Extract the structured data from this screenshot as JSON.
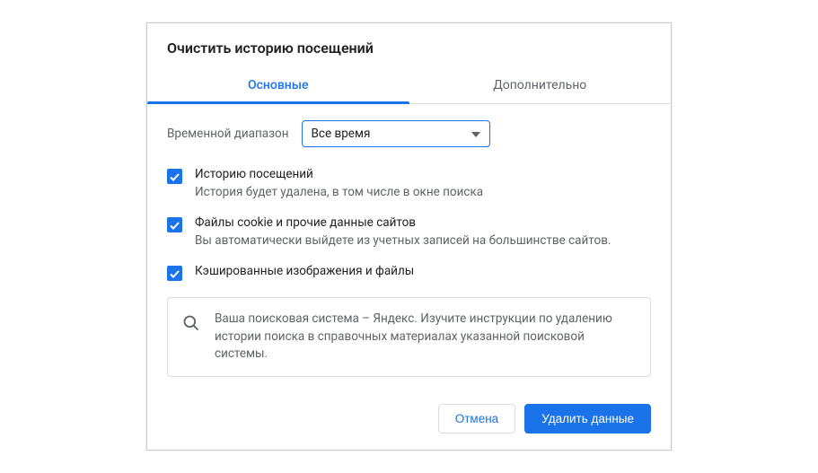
{
  "dialog": {
    "title": "Очистить историю посещений"
  },
  "tabs": {
    "basic": "Основные",
    "advanced": "Дополнительно"
  },
  "timeRange": {
    "label": "Временной диапазон",
    "selected": "Все время"
  },
  "items": [
    {
      "title": "Историю посещений",
      "desc": "История будет удалена, в том числе в окне поиска",
      "checked": true
    },
    {
      "title": "Файлы cookie и прочие данные сайтов",
      "desc": "Вы автоматически выйдете из учетных записей на большинстве сайтов.",
      "checked": true
    },
    {
      "title": "Кэшированные изображения и файлы",
      "desc": "",
      "checked": true
    }
  ],
  "info": {
    "text": "Ваша поисковая система – Яндекс. Изучите инструкции по удалению истории поиска в справочных материалах указанной поисковой системы."
  },
  "footer": {
    "cancel": "Отмена",
    "confirm": "Удалить данные"
  }
}
